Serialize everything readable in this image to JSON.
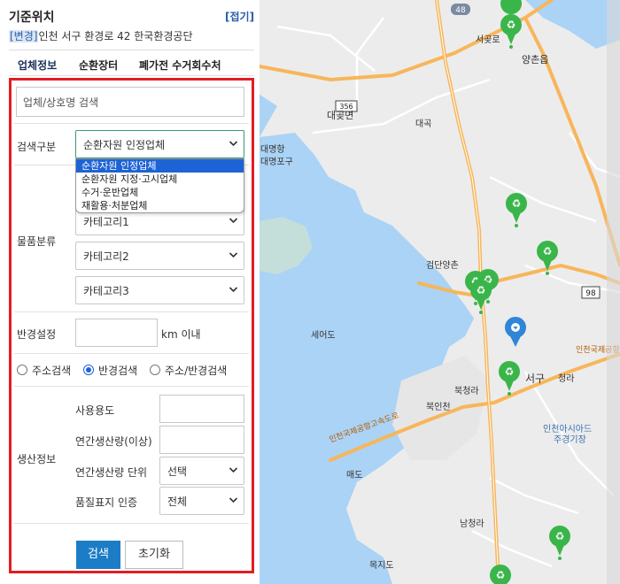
{
  "header": {
    "title": "기준위치",
    "fold_label": "[접기]"
  },
  "location": {
    "change_label": "[변경]",
    "address": "인천 서구 환경로 42 한국환경공단"
  },
  "tabs": [
    {
      "label": "업체정보",
      "active": true
    },
    {
      "label": "순환장터",
      "active": false
    },
    {
      "label": "폐가전 수거회수처",
      "active": false
    }
  ],
  "search": {
    "placeholder": "업체/상호명 검색"
  },
  "search_type": {
    "label": "검색구분",
    "selected": "순환자원 인정업체",
    "options": [
      "순환자원 인정업체",
      "순환자원 지정·고시업체",
      "수거·운반업체",
      "재활용·처분업체"
    ]
  },
  "category": {
    "label": "물품분류",
    "selects": [
      "카테고리1",
      "카테고리2",
      "카테고리3"
    ]
  },
  "radius": {
    "label": "반경설정",
    "value": "",
    "unit": "km 이내"
  },
  "search_mode": {
    "options": [
      "주소검색",
      "반경검색",
      "주소/반경검색"
    ],
    "selected_index": 1
  },
  "production": {
    "label": "생산정보",
    "usage_label": "사용용도",
    "usage_value": "",
    "annual_label": "연간생산량(이상)",
    "annual_value": "",
    "unit_label": "연간생산량 단위",
    "unit_selected": "선택",
    "quality_label": "품질표지 인증",
    "quality_selected": "전체"
  },
  "buttons": {
    "search": "검색",
    "reset": "초기화"
  },
  "map": {
    "place_labels": [
      "서곶로",
      "양촌읍",
      "대곶면",
      "대명항",
      "대명포구",
      "대곡",
      "검단양촌",
      "세어도",
      "서구",
      "청라",
      "북청라",
      "북인천",
      "인천아시아드",
      "주경기장",
      "매도",
      "남청라",
      "목지도",
      "인천국제공항",
      "인천국제공항고속도로"
    ],
    "road_numbers": [
      "48",
      "356",
      "98"
    ],
    "colors": {
      "water": "#abd3f5",
      "land": "#ececec",
      "road_major": "#f7b65a",
      "road_minor": "#ffffff",
      "marker_green": "#3ab54a",
      "marker_blue": "#2f86d6"
    }
  }
}
